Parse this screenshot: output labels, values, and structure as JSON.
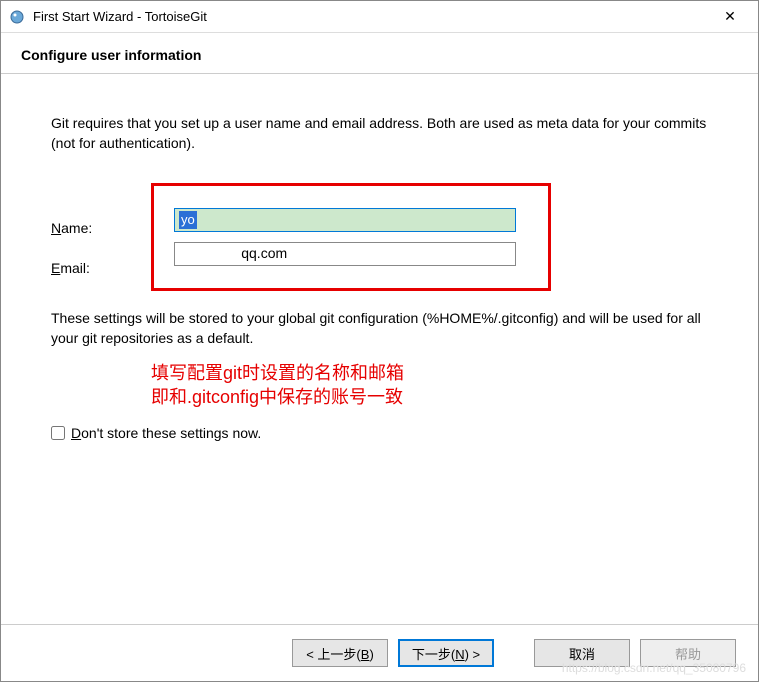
{
  "titlebar": {
    "title": "First Start Wizard - TortoiseGit",
    "close": "✕"
  },
  "header": {
    "title": "Configure user information"
  },
  "content": {
    "description": "Git requires that you set up a user name and email address. Both are used as meta data for your commits (not for authentication).",
    "name_label_prefix": "N",
    "name_label_rest": "ame:",
    "email_label_prefix": "E",
    "email_label_rest": "mail:",
    "name_value": "yo",
    "email_value_suffix": "qq.com",
    "info_text": "These settings will be stored to your global git configuration (%HOME%/.gitconfig) and will be used for all your git repositories as a default.",
    "annotation_line1": "填写配置git时设置的名称和邮箱",
    "annotation_line2": "即和.gitconfig中保存的账号一致",
    "checkbox_prefix": "D",
    "checkbox_rest": "on't store these settings now."
  },
  "buttons": {
    "back": "< 上一步(B)",
    "next": "下一步(N) >",
    "cancel": "取消",
    "help": "帮助"
  },
  "watermark": "https://blog.csdn.net/qq_35080796"
}
